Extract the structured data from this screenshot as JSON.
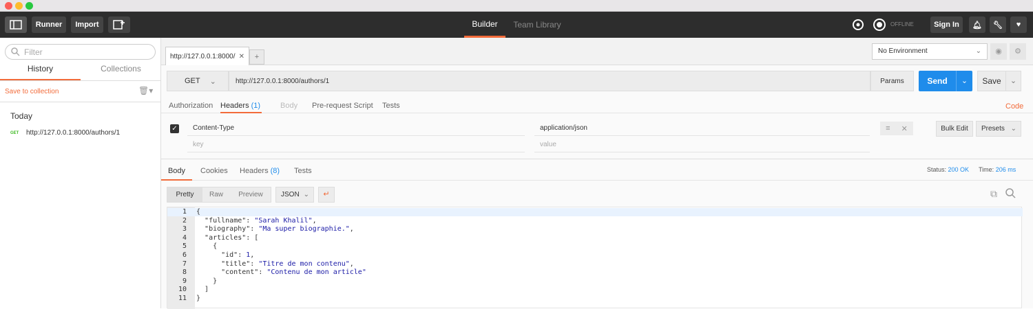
{
  "toolbar": {
    "runner": "Runner",
    "import": "Import",
    "builder": "Builder",
    "team_library": "Team Library",
    "offline": "OFFLINE",
    "sign_in": "Sign In"
  },
  "sidebar": {
    "filter_placeholder": "Filter",
    "tab_history": "History",
    "tab_collections": "Collections",
    "save_to_collection": "Save to collection",
    "today": "Today",
    "history_items": [
      {
        "method": "GET",
        "url": "http://127.0.0.1:8000/authors/1"
      }
    ]
  },
  "request_tab": {
    "label": "http://127.0.0.1:8000/",
    "add": "+"
  },
  "environment": {
    "selected": "No Environment"
  },
  "request": {
    "method": "GET",
    "url": "http://127.0.0.1:8000/authors/1",
    "params": "Params",
    "send": "Send",
    "save": "Save"
  },
  "req_tabs": {
    "authorization": "Authorization",
    "headers": "Headers",
    "headers_count": "(1)",
    "body": "Body",
    "prerequest": "Pre-request Script",
    "tests": "Tests",
    "code": "Code"
  },
  "headers": {
    "key": "Content-Type",
    "value": "application/json",
    "key_placeholder": "key",
    "value_placeholder": "value",
    "bulk_edit": "Bulk Edit",
    "presets": "Presets"
  },
  "res_tabs": {
    "body": "Body",
    "cookies": "Cookies",
    "headers": "Headers",
    "headers_count": "(8)",
    "tests": "Tests",
    "status_label": "Status:",
    "status": "200 OK",
    "time_label": "Time:",
    "time": "206 ms"
  },
  "view": {
    "pretty": "Pretty",
    "raw": "Raw",
    "preview": "Preview",
    "format": "JSON"
  },
  "response_lines": [
    "{",
    "  \"fullname\": \"Sarah Khalil\",",
    "  \"biography\": \"Ma super biographie.\",",
    "  \"articles\": [",
    "    {",
    "      \"id\": 1,",
    "      \"title\": \"Titre de mon contenu\",",
    "      \"content\": \"Contenu de mon article\"",
    "    }",
    "  ]",
    "}"
  ],
  "line_numbers": [
    "1",
    "2",
    "3",
    "4",
    "5",
    "6",
    "7",
    "8",
    "9",
    "10",
    "11"
  ],
  "colors": {
    "accent": "#f26b3a",
    "send": "#1f8ceb",
    "toolbar": "#2d2d2d"
  }
}
